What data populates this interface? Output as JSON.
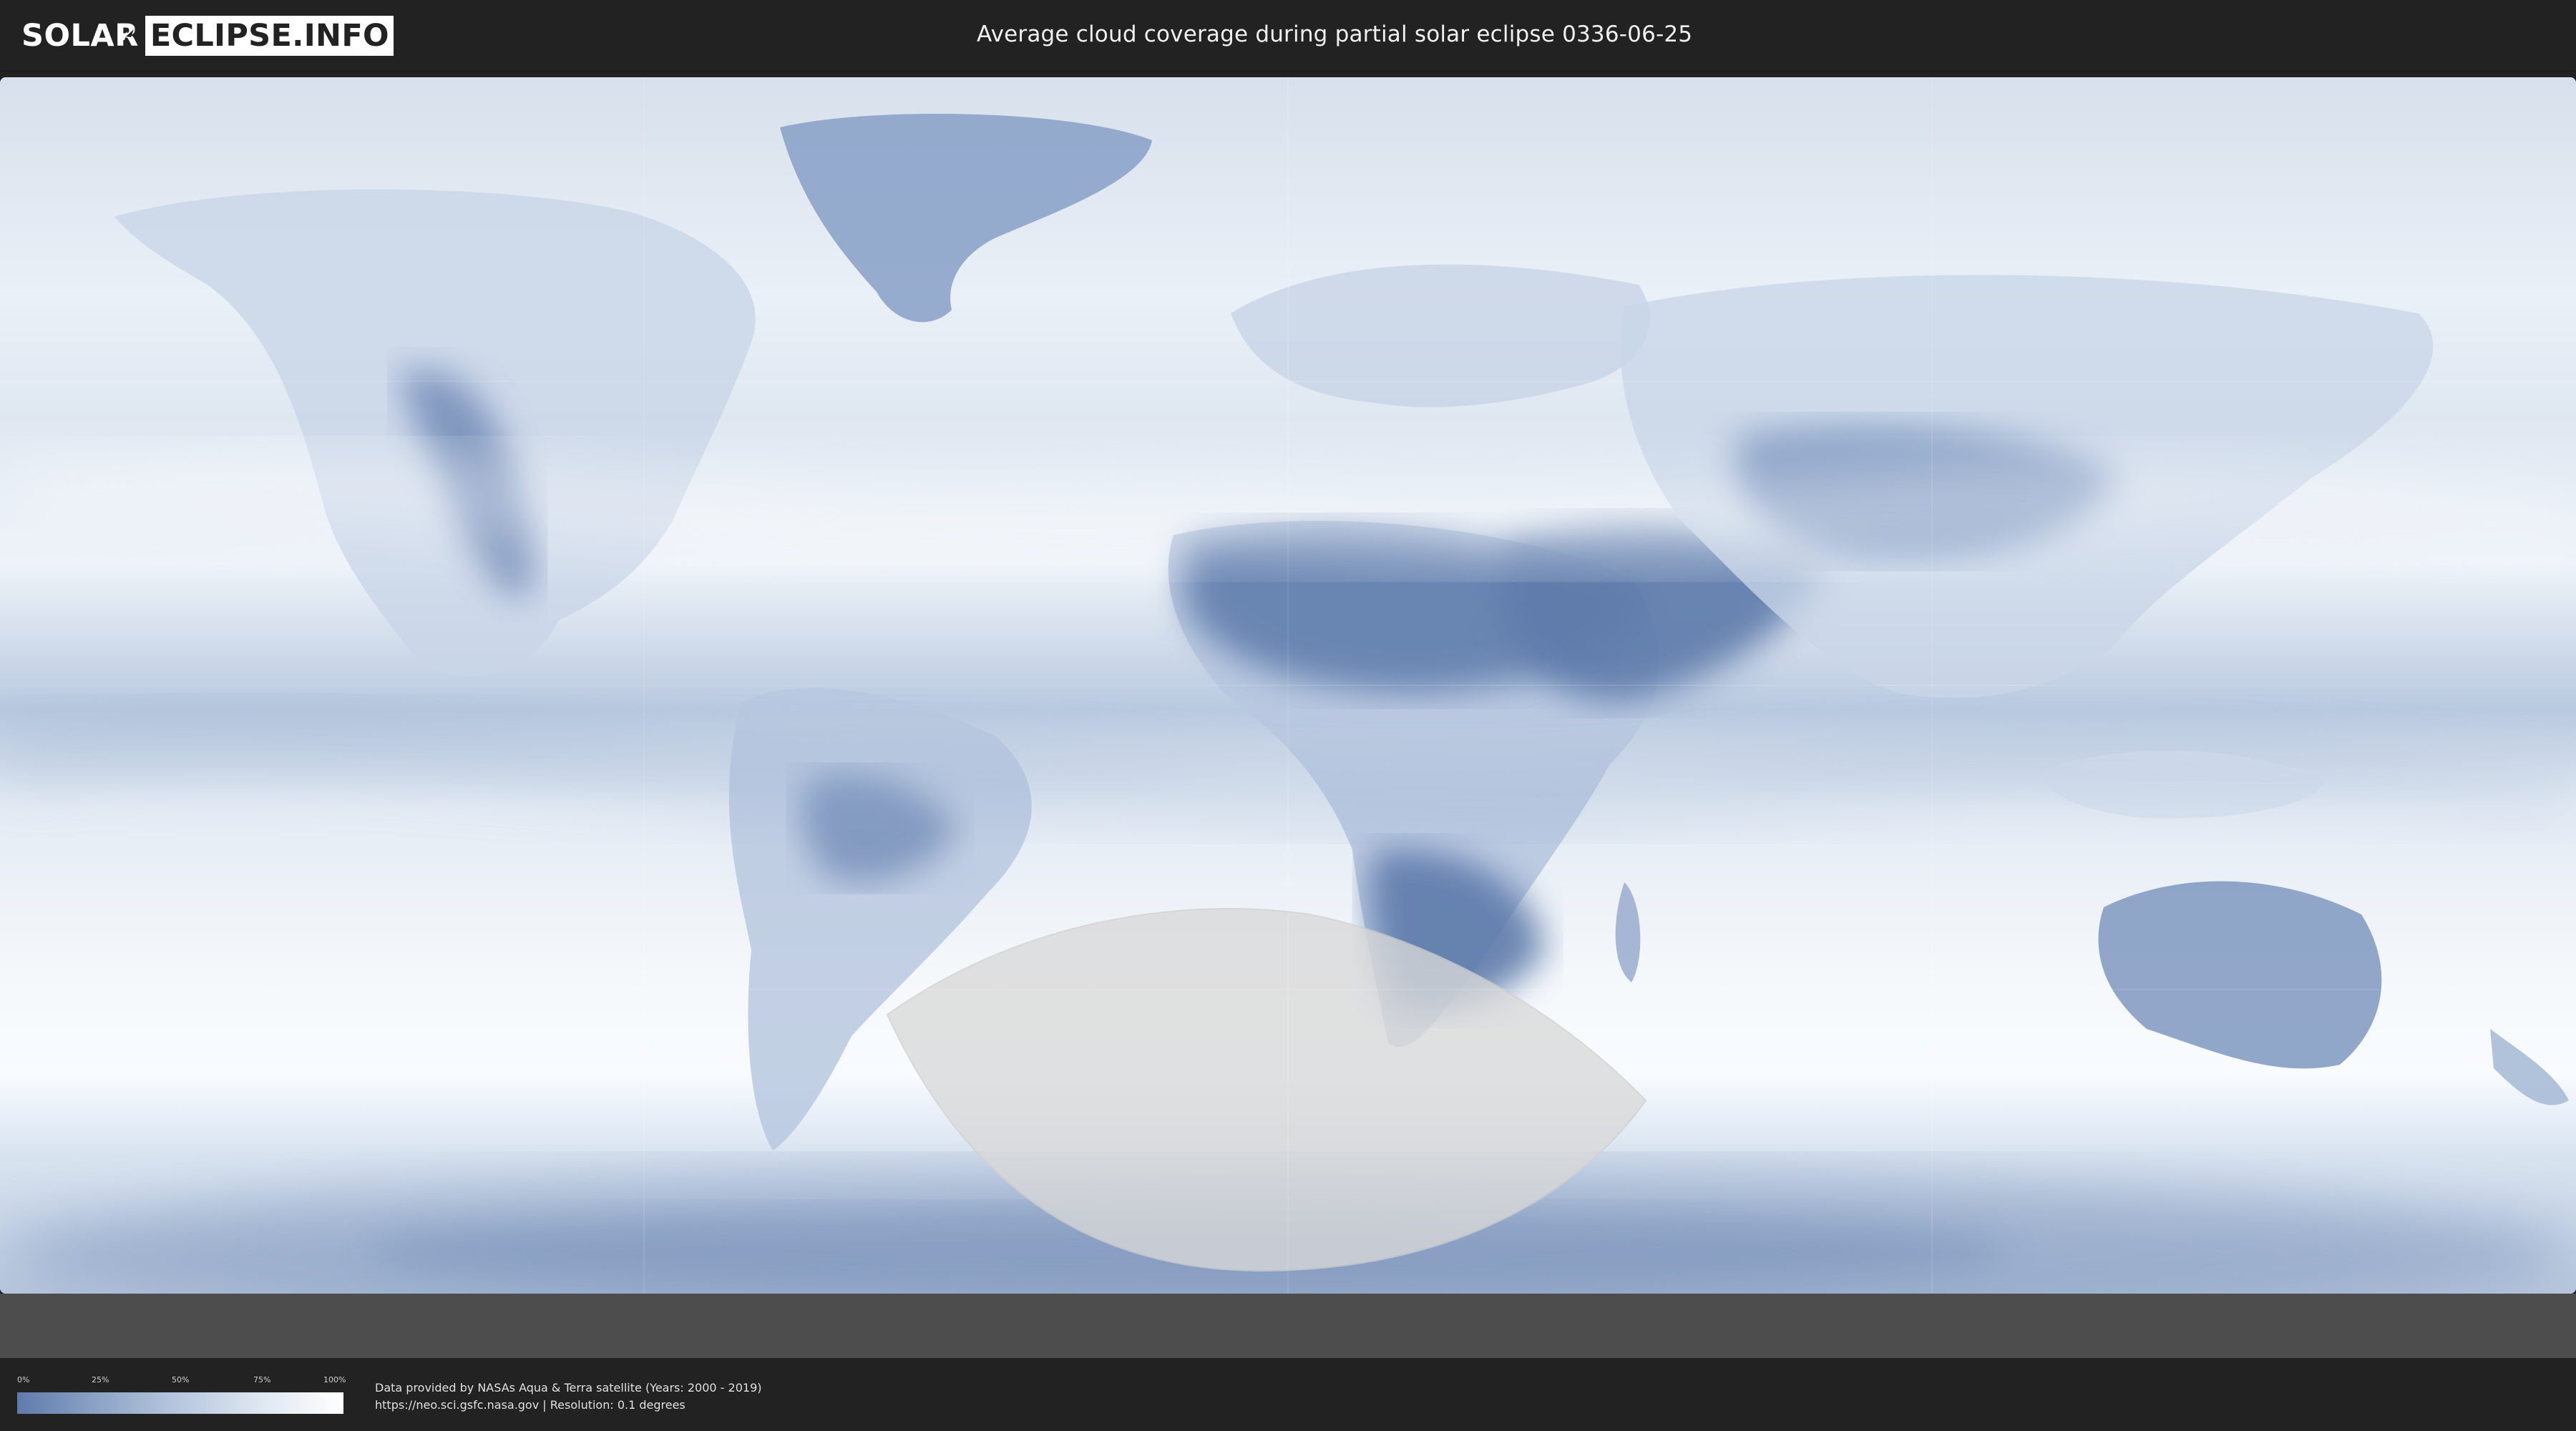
{
  "header": {
    "logo_left": "SOLAR",
    "logo_right": "ECLIPSE.INFO",
    "title": "Average cloud coverage during partial solar eclipse 0336-06-25"
  },
  "legend": {
    "labels": [
      "0%",
      "25%",
      "50%",
      "75%",
      "100%"
    ],
    "colors": {
      "low": "#5f7bab",
      "mid": "#b8c8df",
      "high": "#ffffff"
    }
  },
  "footer": {
    "line1": "Data provided by NASAs Aqua & Terra satellite (Years: 2000 - 2019)",
    "line2": "https://neo.sci.gsfc.nasa.gov | Resolution: 0.1 degrees"
  },
  "map": {
    "base_color": "#e7edf5",
    "land_clear_color": "#5f7bab",
    "eclipse_overlay_color": "#d9d9d9"
  }
}
